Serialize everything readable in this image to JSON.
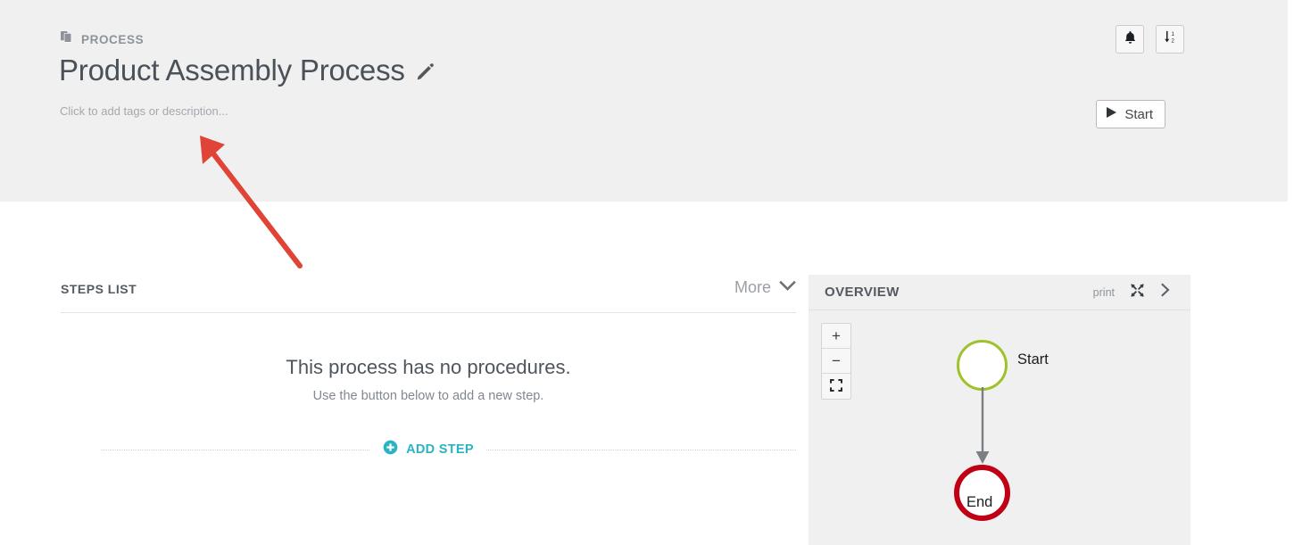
{
  "header": {
    "breadcrumb_icon": "copy-documents-icon",
    "breadcrumb_label": "PROCESS",
    "title": "Product Assembly Process",
    "edit_icon": "pencil-icon",
    "subtitle_placeholder": "Click to add tags or description...",
    "actions": {
      "notifications_icon": "bell-icon",
      "sort_icon": "sort-numeric-down-icon",
      "start_label": "Start",
      "start_icon": "play-icon"
    }
  },
  "steps": {
    "title": "STEPS LIST",
    "more_label": "More",
    "more_icon": "chevron-down-icon",
    "empty_title": "This process has no procedures.",
    "empty_subtitle": "Use the button below to add a new step.",
    "add_step_label": "ADD STEP",
    "add_step_icon": "plus-circle-icon"
  },
  "overview": {
    "title": "OVERVIEW",
    "print_label": "print",
    "expand_icon": "expand-arrows-icon",
    "collapse_icon": "chevron-right-icon",
    "zoom_in_label": "+",
    "zoom_out_label": "−",
    "fit_icon": "fit-to-screen-icon",
    "diagram": {
      "nodes": [
        {
          "id": "start",
          "label": "Start",
          "shape": "circle",
          "border_color": "#9dc22a"
        },
        {
          "id": "end",
          "label": "End",
          "shape": "circle",
          "border_color": "#c00014"
        }
      ],
      "edges": [
        {
          "from": "start",
          "to": "end",
          "color": "#777777"
        }
      ]
    }
  },
  "annotation": {
    "arrow_color": "#df4436",
    "points_to": "Click to add tags or description..."
  },
  "colors": {
    "header_background": "#f0f0f0",
    "accent": "#2bb3c4",
    "page_background": "#ffffff"
  }
}
